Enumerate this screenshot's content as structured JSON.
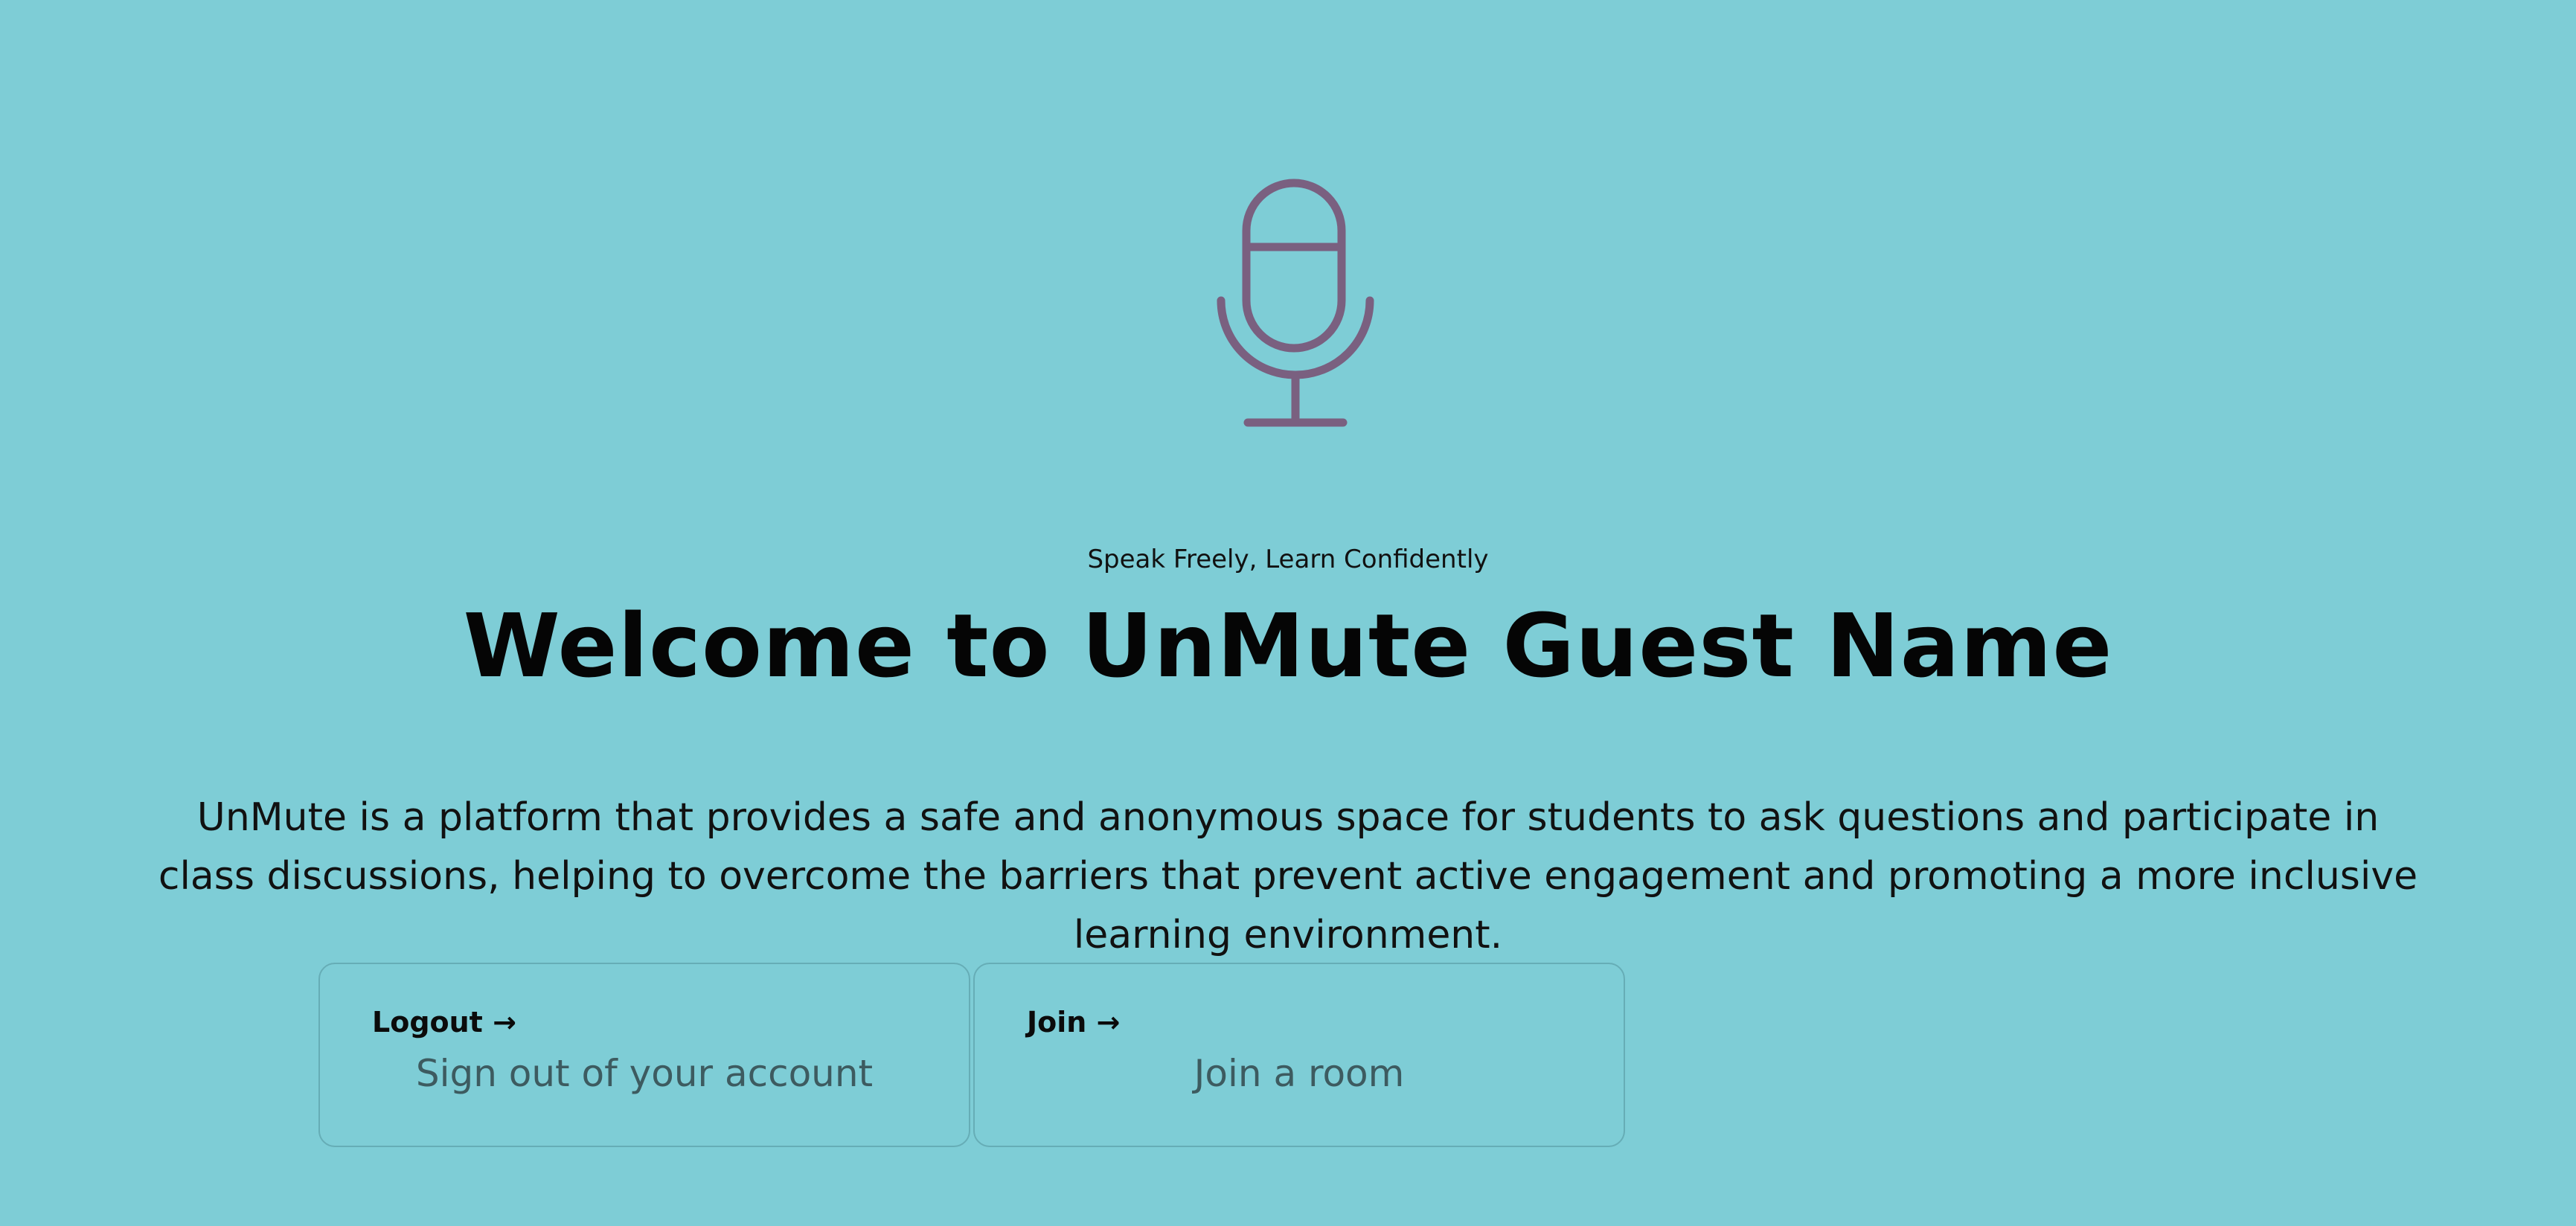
{
  "hero": {
    "icon": "microphone-icon",
    "icon_color": "#7a6080",
    "tagline": "Speak Freely, Learn Confidently",
    "title": "Welcome to UnMute Guest Name",
    "description": "UnMute is a platform that provides a safe and anonymous space for students to ask questions and participate in class discussions, helping to overcome the barriers that prevent active engagement and promoting a more inclusive learning environment."
  },
  "cards": {
    "logout": {
      "title": "Logout →",
      "subtitle": "Sign out of your account"
    },
    "join": {
      "title": "Join →",
      "subtitle": "Join a room"
    }
  },
  "colors": {
    "background": "#7ecdd6",
    "card_border": "#66adb6",
    "subtitle": "#3d5b60"
  }
}
